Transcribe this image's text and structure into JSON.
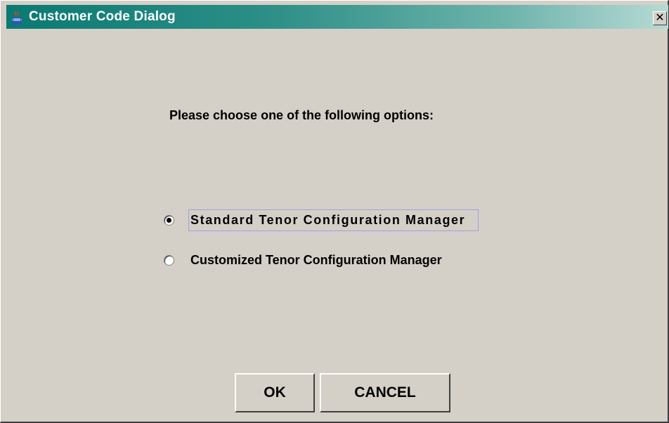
{
  "window": {
    "title": "Customer Code Dialog",
    "close_glyph": "✕",
    "title_icon": "java-cup-icon",
    "colors": {
      "titlebar_start": "#0a7a72",
      "titlebar_end": "#b6dad4",
      "background": "#d4d0c8"
    }
  },
  "prompt": "Please choose one of the following options:",
  "options": [
    {
      "label": "Standard Tenor Configuration Manager",
      "selected": true
    },
    {
      "label": "Customized Tenor Configuration Manager",
      "selected": false
    }
  ],
  "buttons": {
    "ok_label": "OK",
    "cancel_label": "CANCEL"
  }
}
